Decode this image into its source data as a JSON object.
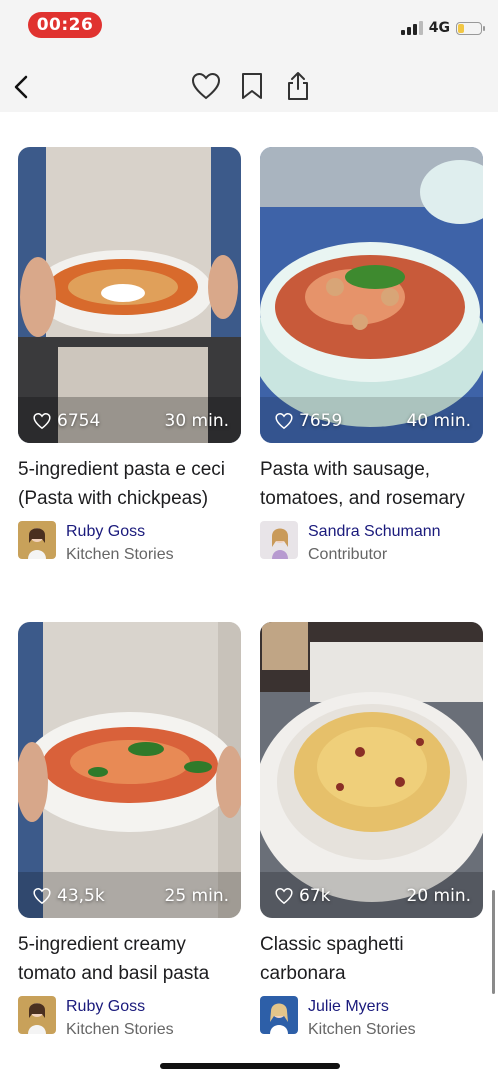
{
  "status_bar": {
    "time": "00:26",
    "network": "4G",
    "battery_level": 0.25,
    "colors": {
      "time_pill": "#e0322f",
      "battery": "#f2c744"
    }
  },
  "header": {
    "icons": [
      "chevron-left-icon",
      "heart-icon",
      "bookmark-icon",
      "share-icon"
    ]
  },
  "recipes": [
    {
      "likes": "6754",
      "duration": "30 min.",
      "title": "5-ingredient pasta e ceci (Pasta with chickpeas)",
      "author": "Ruby Goss",
      "role": "Kitchen Stories"
    },
    {
      "likes": "7659",
      "duration": "40 min.",
      "title": "Pasta with sausage, tomatoes, and rosemary",
      "author": "Sandra Schumann",
      "role": "Contributor"
    },
    {
      "likes": "43,5k",
      "duration": "25 min.",
      "title": "5-ingredient creamy tomato and basil pasta",
      "author": "Ruby Goss",
      "role": "Kitchen Stories"
    },
    {
      "likes": "67k",
      "duration": "20 min.",
      "title": "Classic spaghetti carbonara",
      "author": "Julie Myers",
      "role": "Kitchen Stories"
    }
  ]
}
